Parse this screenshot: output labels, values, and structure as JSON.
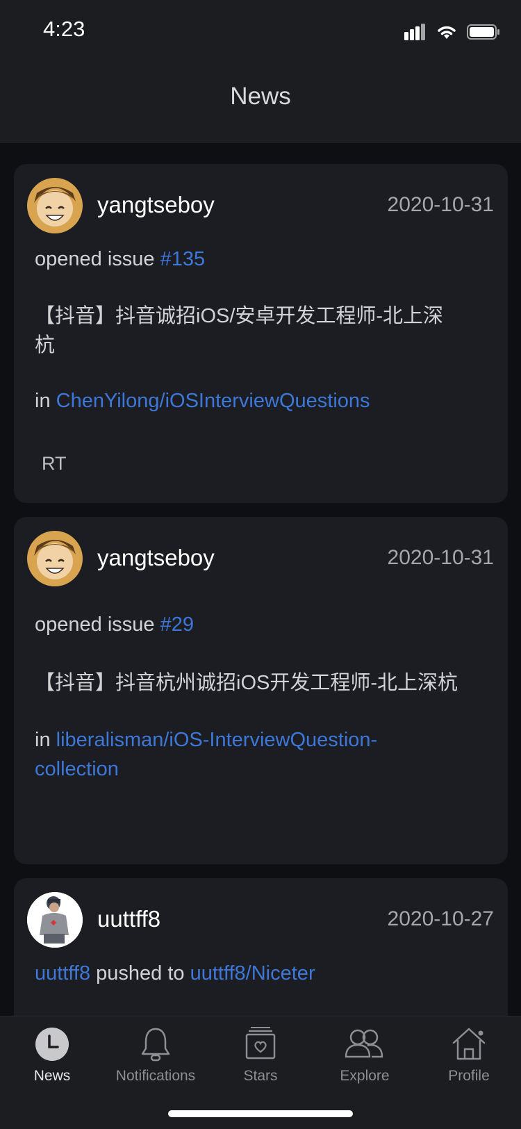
{
  "status": {
    "time": "4:23"
  },
  "nav": {
    "title": "News"
  },
  "feed": [
    {
      "username": "yangtseboy",
      "date": "2020-10-31",
      "action": "opened issue ",
      "issue": "#135",
      "title_line1": "【抖音】抖音诚招iOS/安卓开发工程师-北上深",
      "title_line2": "杭",
      "in": "in ",
      "repo": "ChenYilong/iOSInterviewQuestions",
      "body": "RT"
    },
    {
      "username": "yangtseboy",
      "date": "2020-10-31",
      "action": "opened issue ",
      "issue": "#29",
      "title_line1": "【抖音】抖音杭州诚招iOS开发工程师-北上深杭",
      "in": "in ",
      "repo_line1": "liberalisman/iOS-InterviewQuestion-",
      "repo_line2": "collection"
    },
    {
      "username": "uuttff8",
      "date": "2020-10-27",
      "actor": "uuttff8",
      "action": " pushed to ",
      "repo": "uuttff8/Niceter"
    }
  ],
  "tabs": [
    {
      "label": "News",
      "icon": "clock-icon"
    },
    {
      "label": "Notifications",
      "icon": "bell-icon"
    },
    {
      "label": "Stars",
      "icon": "star-box-icon"
    },
    {
      "label": "Explore",
      "icon": "people-icon"
    },
    {
      "label": "Profile",
      "icon": "house-icon"
    }
  ],
  "colors": {
    "link": "#3d78d8",
    "card": "#1c1d22",
    "background": "#0e0f12"
  }
}
